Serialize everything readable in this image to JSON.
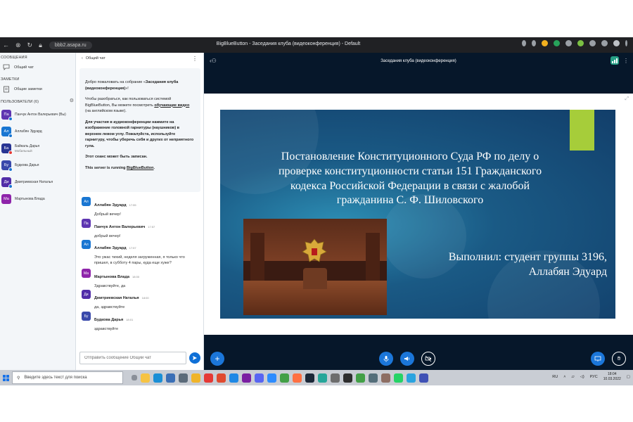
{
  "browser": {
    "url": "bbb2.asapa.ru",
    "window_title": "BigBlueButton - Заседания клуба (видеоконференция) - Default"
  },
  "sidebar": {
    "messages_title": "СООБЩЕНИЯ",
    "public_chat": "Общий чат",
    "notes_title": "ЗАМЕТКИ",
    "shared_notes": "Общие заметки",
    "users_title": "ПОЛЬЗОВАТЕЛИ (6)",
    "users": [
      {
        "initials": "Па",
        "name": "Панчук Антон Валерьевич (Вы)",
        "sub": "",
        "color": "#5e35b1",
        "dot": "#1976d2"
      },
      {
        "initials": "Ал",
        "name": "Аллабян Эдуард",
        "sub": "",
        "color": "#1976d2",
        "dot": "#1976d2"
      },
      {
        "initials": "Ба",
        "name": "Байкаль Дарья",
        "sub": "Мобильный",
        "color": "#283593",
        "dot": "#e53935"
      },
      {
        "initials": "Бу",
        "name": "Будкова Дарья",
        "sub": "",
        "color": "#3949ab",
        "dot": "#1976d2"
      },
      {
        "initials": "Ди",
        "name": "Дмитриевская Наталья",
        "sub": "",
        "color": "#512da8",
        "dot": "#1976d2"
      },
      {
        "initials": "Ма",
        "name": "Мартынова Влада",
        "sub": "",
        "color": "#8e24aa",
        "dot": ""
      }
    ]
  },
  "chat": {
    "back_label": "Общий чат",
    "welcome": {
      "p1_pre": "Добро пожаловать на собрание «",
      "p1_bold": "Заседания клуба (видеоконференция)",
      "p1_post": "»!",
      "p2_pre": "Чтобы разобраться, как пользоваться системой BigBlueButton, Вы можете посмотреть ",
      "p2_link": "обучающие видео",
      "p2_post": " (на английском языке).",
      "p3_bold": "Для участия в аудиоконференции нажмите на изображение головной гарнитуры (наушников) в верхнем левом углу. Пожалуйста, используйте гарнитуру, чтобы уберечь себя и других от неприятного гула.",
      "p4_bold": "Этот сеанс может быть записан.",
      "p5_bold_pre": "This server is running ",
      "p5_link": "BigBlueButton",
      "p5_post": "."
    },
    "messages": [
      {
        "initials": "Ал",
        "color": "#1976d2",
        "name": "Аллабян Эдуард",
        "time": "17:55",
        "text": "Добрый вечер!"
      },
      {
        "initials": "Па",
        "color": "#5e35b1",
        "name": "Панчук Антон Валерьевич",
        "time": "17:57",
        "text": "добрый вечер!"
      },
      {
        "initials": "Ал",
        "color": "#1976d2",
        "name": "Аллабян Эдуард",
        "time": "17:57",
        "text": "Это ужас тихий, неделя загруженная, я только что пришел, в субботу 4 пары, куда еще хуже?"
      },
      {
        "initials": "Ма",
        "color": "#8e24aa",
        "name": "Мартынова Влада",
        "time": "18:00",
        "text": "Здравствуйте, да"
      },
      {
        "initials": "Ди",
        "color": "#512da8",
        "name": "Дмитриевская Наталья",
        "time": "18:00",
        "text": "да, здравствуйте"
      },
      {
        "initials": "Бу",
        "color": "#3949ab",
        "name": "Будкова Дарья",
        "time": "18:01",
        "text": "здравствуйте"
      }
    ],
    "input_placeholder": "Отправить сообщение Общий чат"
  },
  "meeting": {
    "title": "Заседания клуба (видеоконференция)"
  },
  "slide": {
    "title": "Постановление Конституционного Суда РФ по делу о проверке конституционности статьи 151 Гражданского кодекса Российской Федерации в связи с жалобой гражданина С. Ф. Шиловского",
    "author_line1": "Выполнил: студент группы 3196,",
    "author_line2": "Аллабян Эдуард"
  },
  "taskbar": {
    "search_placeholder": "Введите здесь текст для поиска",
    "lang": "RU",
    "input_lang": "РУС",
    "time": "18:04",
    "date": "10.03.2022"
  },
  "colors": {
    "accent": "#1b76d9",
    "slide_accent": "#a6cd3a",
    "meeting_bg": "#06172a"
  }
}
